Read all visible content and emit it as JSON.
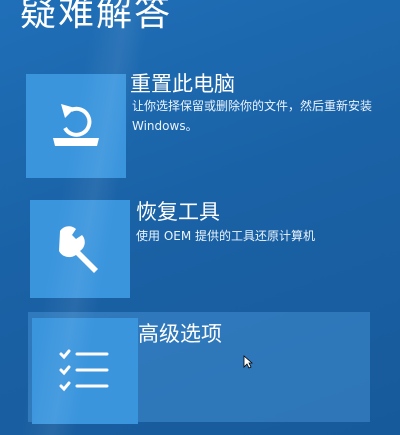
{
  "page": {
    "title": "疑难解答"
  },
  "options": [
    {
      "label": "重置此电脑",
      "description": "让你选择保留或删除你的文件，然后重新安装 Windows。",
      "icon": "reset-pc-icon"
    },
    {
      "label": "恢复工具",
      "description": "使用 OEM 提供的工具还原计算机",
      "icon": "wrench-icon"
    },
    {
      "label": "高级选项",
      "description": "",
      "icon": "checklist-icon"
    }
  ],
  "colors": {
    "background": "#1a62a6",
    "tile": "#3a95dd",
    "selected": "#5aaaeb"
  }
}
